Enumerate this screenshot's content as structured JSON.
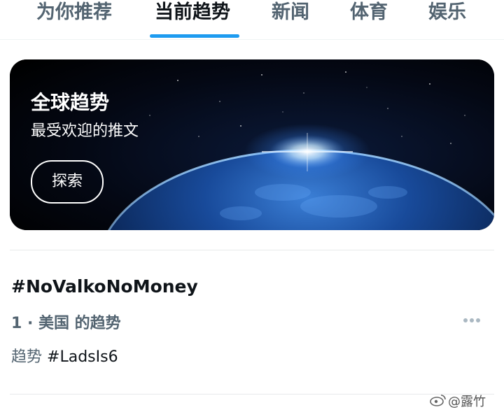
{
  "tabs": [
    {
      "label": "为你推荐",
      "active": false
    },
    {
      "label": "当前趋势",
      "active": true
    },
    {
      "label": "新闻",
      "active": false
    },
    {
      "label": "体育",
      "active": false
    },
    {
      "label": "娱乐",
      "active": false
    }
  ],
  "banner": {
    "title": "全球趋势",
    "subtitle": "最受欢迎的推文",
    "button_label": "探索",
    "image": "earth-from-space"
  },
  "trend": {
    "title": "#NoValkoNoMoney",
    "meta": "1 · 美国 的趋势",
    "related_prefix": "趋势",
    "related_tag": "#LadsIs6",
    "more_icon": "more-horizontal-icon"
  },
  "watermark": {
    "text": "@露竹",
    "icon": "weibo-icon"
  },
  "colors": {
    "accent": "#1d9bf0",
    "text_primary": "#0f1419",
    "text_secondary": "#536471"
  }
}
